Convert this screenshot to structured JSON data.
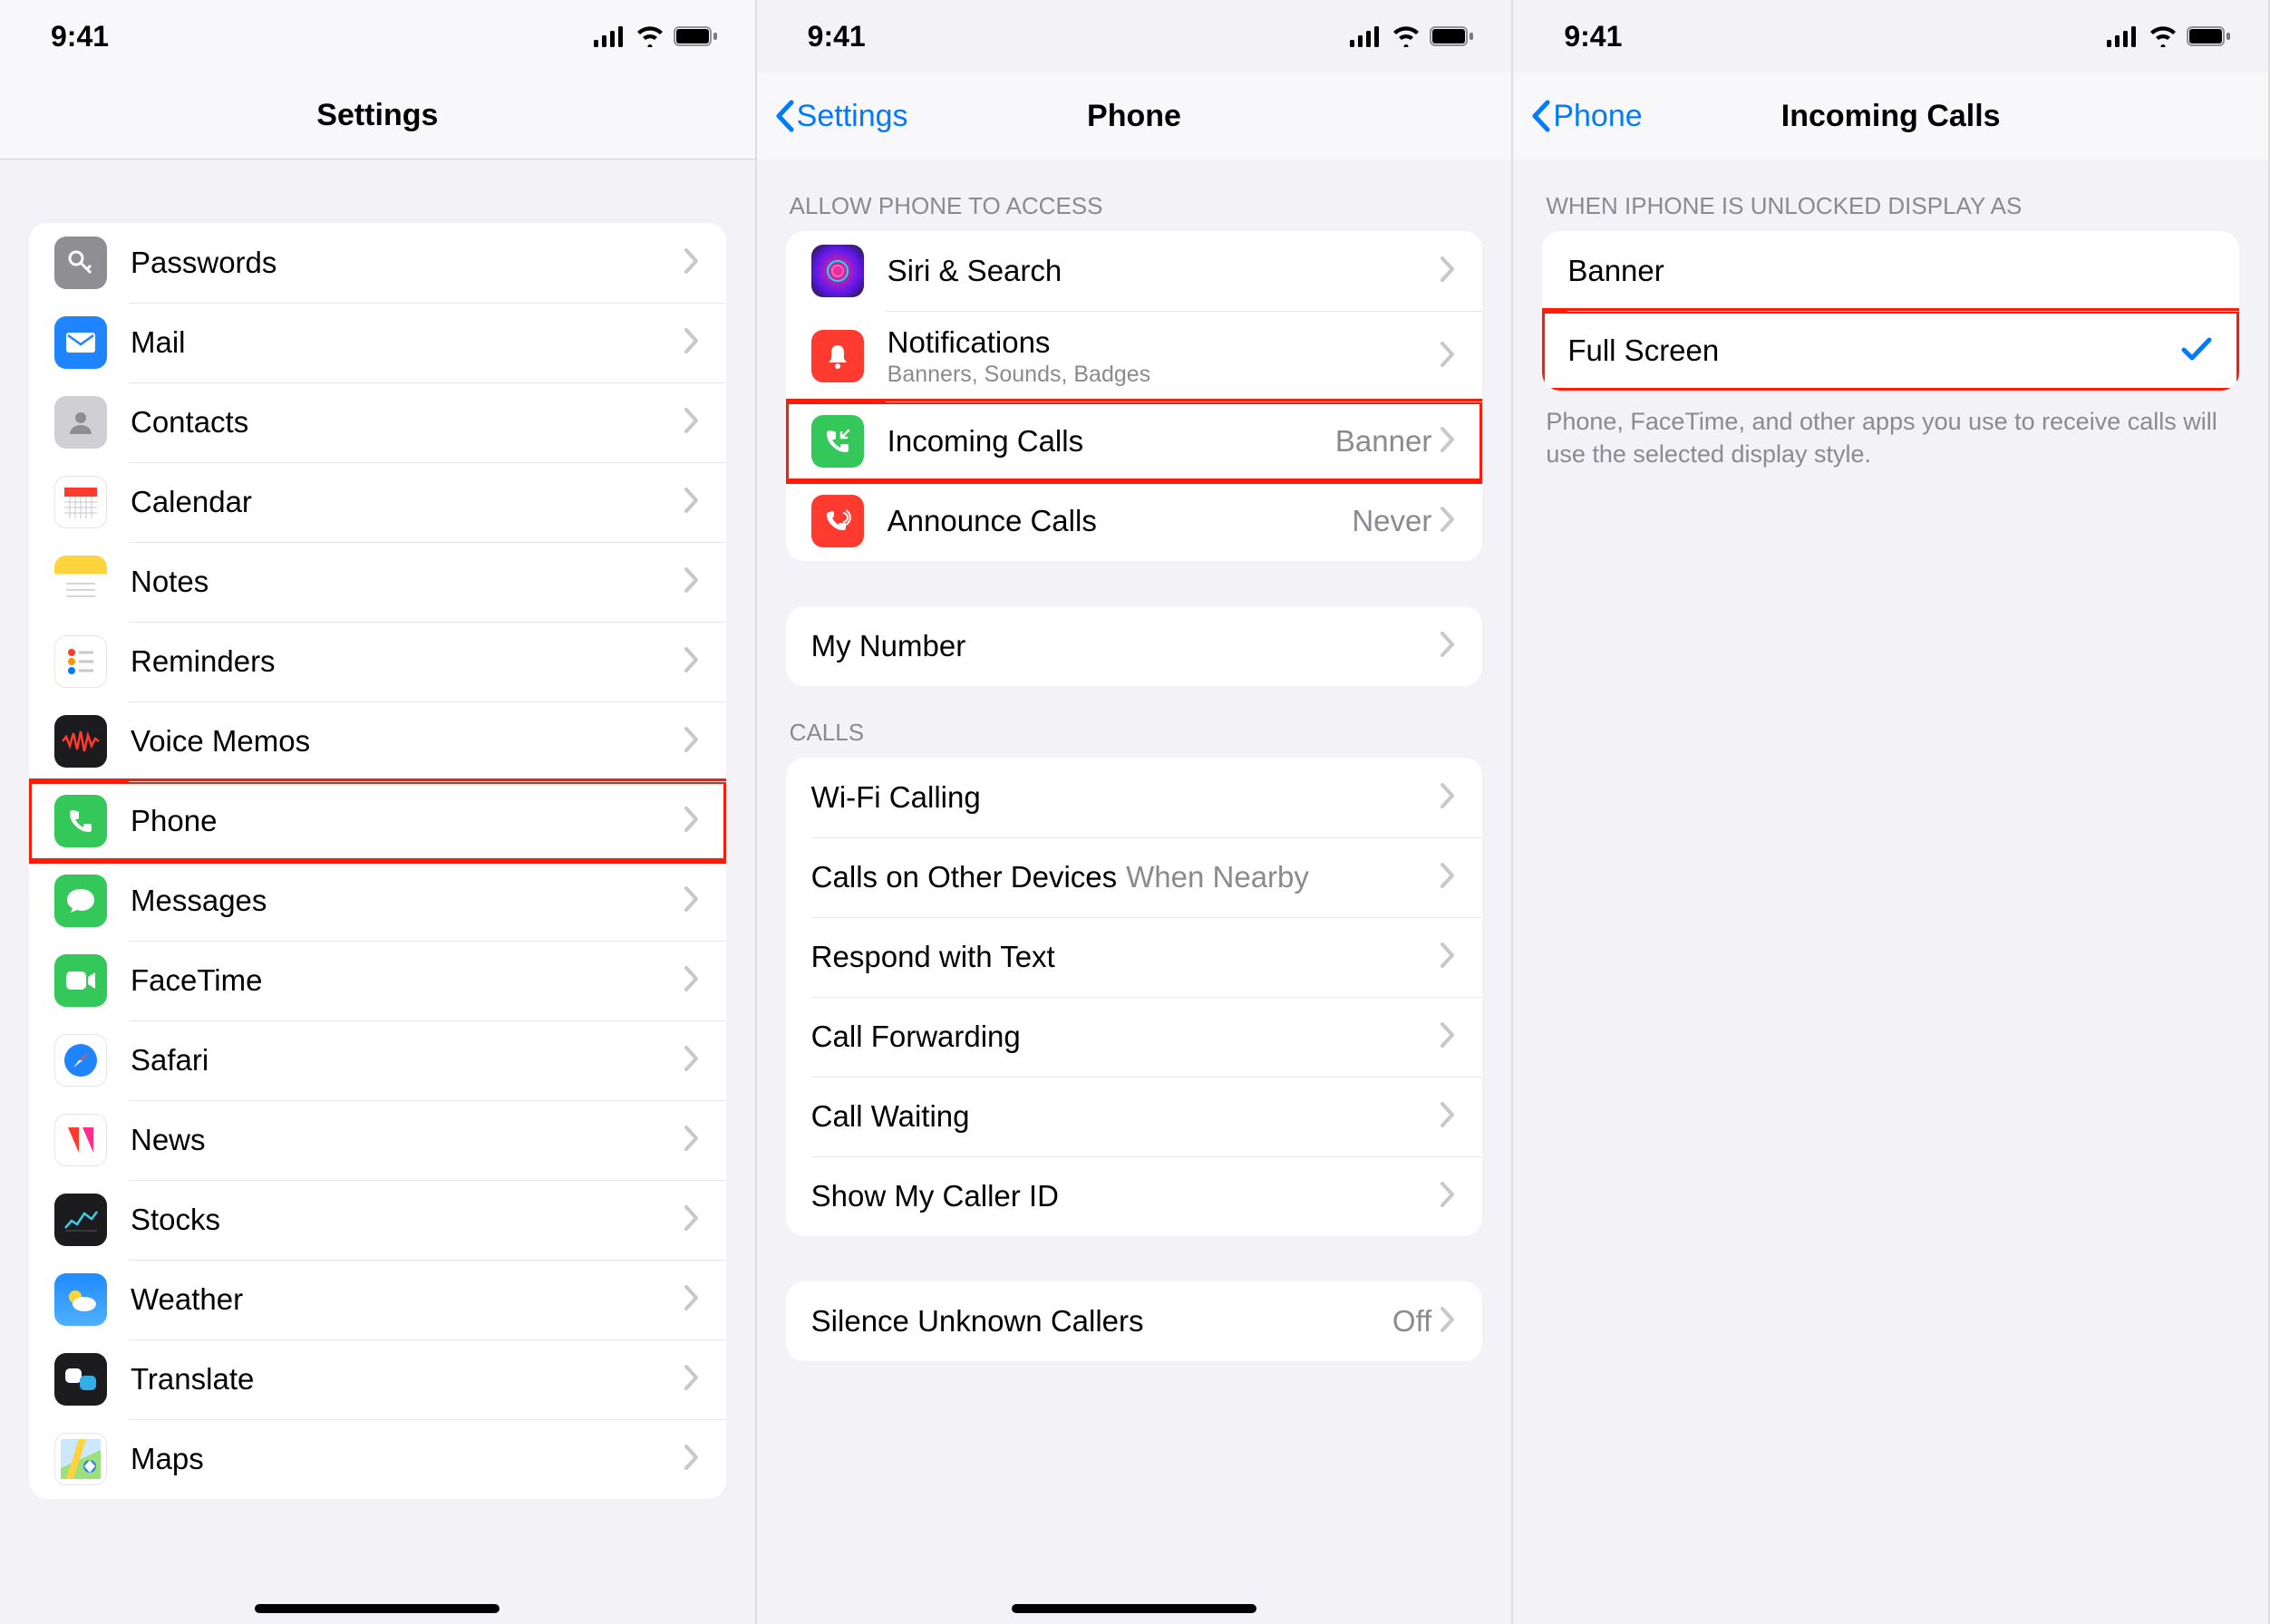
{
  "status": {
    "time": "9:41"
  },
  "panel1": {
    "title": "Settings",
    "rows": [
      {
        "label": "Passwords",
        "icon": "key",
        "bg": "#8e8e93"
      },
      {
        "label": "Mail",
        "icon": "mail",
        "bg": "#1e84ff"
      },
      {
        "label": "Contacts",
        "icon": "contact",
        "bg": "#cfcfd4"
      },
      {
        "label": "Calendar",
        "icon": "calendar",
        "bg": "#ffffff"
      },
      {
        "label": "Notes",
        "icon": "notes",
        "bg": "#fff"
      },
      {
        "label": "Reminders",
        "icon": "reminders",
        "bg": "#fff"
      },
      {
        "label": "Voice Memos",
        "icon": "voicememo",
        "bg": "#1c1c1e"
      },
      {
        "label": "Phone",
        "icon": "phone",
        "bg": "#34c759",
        "highlight": true
      },
      {
        "label": "Messages",
        "icon": "messages",
        "bg": "#34c759"
      },
      {
        "label": "FaceTime",
        "icon": "facetime",
        "bg": "#34c759"
      },
      {
        "label": "Safari",
        "icon": "safari",
        "bg": "#fff"
      },
      {
        "label": "News",
        "icon": "news",
        "bg": "#fff"
      },
      {
        "label": "Stocks",
        "icon": "stocks",
        "bg": "#1c1c1e"
      },
      {
        "label": "Weather",
        "icon": "weather",
        "bg": "#1f8bff"
      },
      {
        "label": "Translate",
        "icon": "translate",
        "bg": "#1c1c1e"
      },
      {
        "label": "Maps",
        "icon": "maps",
        "bg": "#fff"
      }
    ]
  },
  "panel2": {
    "back": "Settings",
    "title": "Phone",
    "group_access": "ALLOW PHONE TO ACCESS",
    "rows_access": [
      {
        "label": "Siri & Search",
        "icon": "siri",
        "bg": "#1c1c1e"
      },
      {
        "label": "Notifications",
        "sub": "Banners, Sounds, Badges",
        "icon": "bell",
        "bg": "#ff3b30"
      },
      {
        "label": "Incoming Calls",
        "value": "Banner",
        "icon": "incoming",
        "bg": "#34c759",
        "highlight": true
      },
      {
        "label": "Announce Calls",
        "value": "Never",
        "icon": "announce",
        "bg": "#ff3b30"
      }
    ],
    "row_mynumber": {
      "label": "My Number"
    },
    "group_calls": "CALLS",
    "rows_calls": [
      {
        "label": "Wi-Fi Calling"
      },
      {
        "label": "Calls on Other Devices",
        "value": "When Nearby"
      },
      {
        "label": "Respond with Text"
      },
      {
        "label": "Call Forwarding"
      },
      {
        "label": "Call Waiting"
      },
      {
        "label": "Show My Caller ID"
      }
    ],
    "rows_silence": [
      {
        "label": "Silence Unknown Callers",
        "value": "Off"
      }
    ]
  },
  "panel3": {
    "back": "Phone",
    "title": "Incoming Calls",
    "group_header": "WHEN IPHONE IS UNLOCKED DISPLAY AS",
    "options": [
      {
        "label": "Banner",
        "checked": false
      },
      {
        "label": "Full Screen",
        "checked": true,
        "highlight": true
      }
    ],
    "footer": "Phone, FaceTime, and other apps you use to receive calls will use the selected display style."
  }
}
